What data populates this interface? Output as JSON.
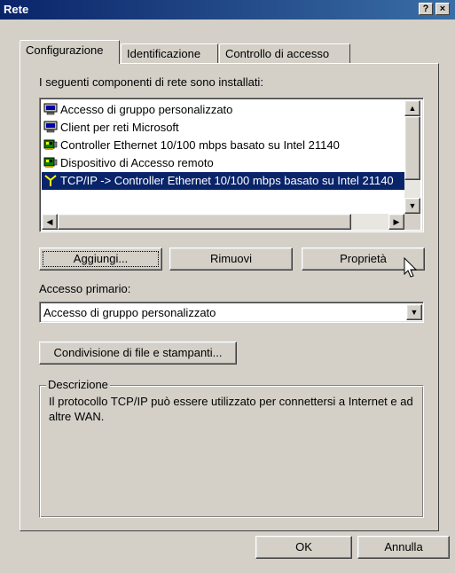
{
  "window": {
    "title": "Rete",
    "help_label": "?",
    "close_label": "×"
  },
  "tabs": [
    {
      "label": "Configurazione"
    },
    {
      "label": "Identificazione"
    },
    {
      "label": "Controllo di accesso"
    }
  ],
  "components_label": "I seguenti componenti di rete sono installati:",
  "components": [
    {
      "label": "Accesso di gruppo personalizzato",
      "icon": "network-client-icon"
    },
    {
      "label": "Client per reti Microsoft",
      "icon": "network-client-icon"
    },
    {
      "label": "Controller Ethernet 10/100 mbps basato su Intel 21140",
      "icon": "network-adapter-icon"
    },
    {
      "label": "Dispositivo di Accesso remoto",
      "icon": "network-adapter-icon"
    },
    {
      "label": "TCP/IP -> Controller Ethernet 10/100 mbps basato su Intel 21140",
      "icon": "protocol-icon",
      "selected": true
    }
  ],
  "buttons": {
    "add": "Aggiungi...",
    "remove": "Rimuovi",
    "properties": "Proprietà"
  },
  "primary_logon": {
    "label": "Accesso primario:",
    "value": "Accesso di gruppo personalizzato"
  },
  "file_sharing_button": "Condivisione di file e stampanti...",
  "description": {
    "title": "Descrizione",
    "text": "Il protocollo TCP/IP può essere utilizzato per connettersi a Internet e ad altre WAN."
  },
  "footer": {
    "ok": "OK",
    "cancel": "Annulla"
  },
  "colors": {
    "face": "#d4d0c8",
    "title_bar": "#0a246a",
    "selection": "#0a246a"
  }
}
